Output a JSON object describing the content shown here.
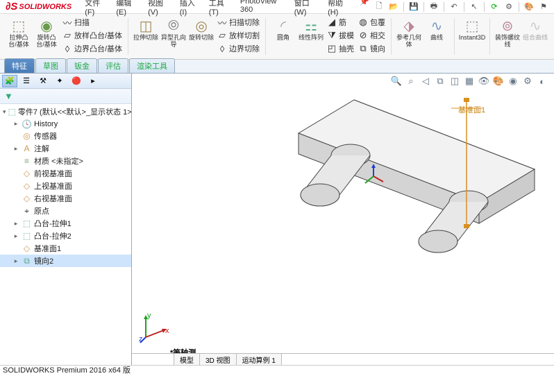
{
  "app": {
    "logo_text": "SOLIDWORKS",
    "status": "SOLIDWORKS Premium 2016 x64 版"
  },
  "menu": {
    "file": "文件(F)",
    "edit": "编辑(E)",
    "view": "视图(V)",
    "insert": "插入(I)",
    "tools": "工具(T)",
    "photoview": "PhotoView 360",
    "window": "窗口(W)",
    "help": "帮助(H)"
  },
  "ribbon": {
    "extrude_boss": "拉伸凸台/基体",
    "revolve_boss": "旋转凸台/基体",
    "sweep": "扫描",
    "loft_boss": "放样凸台/基体",
    "boundary_boss": "边界凸台/基体",
    "extrude_cut": "拉伸切除",
    "hole_wizard": "异型孔向导",
    "revolve_cut": "旋转切除",
    "sweep_cut": "扫描切除",
    "loft_cut": "放样切割",
    "boundary_cut": "边界切除",
    "fillet": "圆角",
    "linear_pattern": "线性阵列",
    "rib": "筋",
    "draft": "拔模",
    "shell": "抽壳",
    "wrap": "包覆",
    "intersect": "相交",
    "mirror": "镜向",
    "ref_geom": "参考几何体",
    "curves": "曲线",
    "instant3d": "Instant3D",
    "thread": "装饰螺纹线",
    "composite_curve": "组合曲线"
  },
  "tabs": {
    "feature": "特征",
    "sketch": "草图",
    "sheet_metal": "钣金",
    "evaluate": "评估",
    "render": "渲染工具"
  },
  "tree": {
    "root": "零件7 (默认<<默认>_显示状态 1>)",
    "history": "History",
    "sensors": "传感器",
    "annotations": "注解",
    "material": "材质 <未指定>",
    "front_plane": "前视基准面",
    "top_plane": "上视基准面",
    "right_plane": "右视基准面",
    "origin": "原点",
    "boss1": "凸台-拉伸1",
    "boss2": "凸台-拉伸2",
    "plane1": "基准面1",
    "mirror2": "镜向2"
  },
  "viewport": {
    "annotation": "基准面1",
    "triad_label": "*等轴测",
    "bottom_tabs": {
      "model": "模型",
      "3dview": "3D 视图",
      "motion": "运动算例 1"
    }
  }
}
